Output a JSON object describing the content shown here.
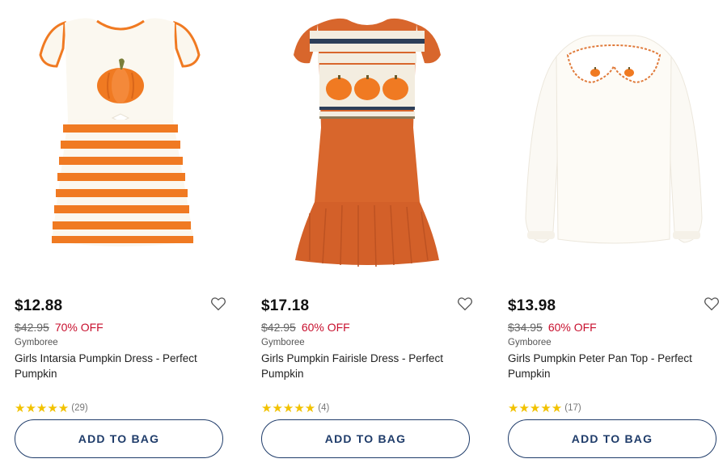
{
  "products": [
    {
      "price": "$12.88",
      "original_price": "$42.95",
      "discount": "70% OFF",
      "brand": "Gymboree",
      "name": "Girls Intarsia Pumpkin Dress - Perfect Pumpkin",
      "stars": "★★★★★",
      "review_count": "(29)",
      "button_label": "ADD TO BAG",
      "image_icon": "pumpkin-striped-dress"
    },
    {
      "price": "$17.18",
      "original_price": "$42.95",
      "discount": "60% OFF",
      "brand": "Gymboree",
      "name": "Girls Pumpkin Fairisle Dress - Perfect Pumpkin",
      "stars": "★★★★★",
      "review_count": "(4)",
      "button_label": "ADD TO BAG",
      "image_icon": "orange-fairisle-dress"
    },
    {
      "price": "$13.98",
      "original_price": "$34.95",
      "discount": "60% OFF",
      "brand": "Gymboree",
      "name": "Girls Pumpkin Peter Pan Top - Perfect Pumpkin",
      "stars": "★★★★★",
      "review_count": "(17)",
      "button_label": "ADD TO BAG",
      "image_icon": "white-peter-pan-top"
    }
  ],
  "colors": {
    "sale_red": "#c8102e",
    "button_navy": "#1f3c6a",
    "star_gold": "#f2c200",
    "pumpkin_orange": "#f07a22",
    "rust_orange": "#d8662c"
  }
}
